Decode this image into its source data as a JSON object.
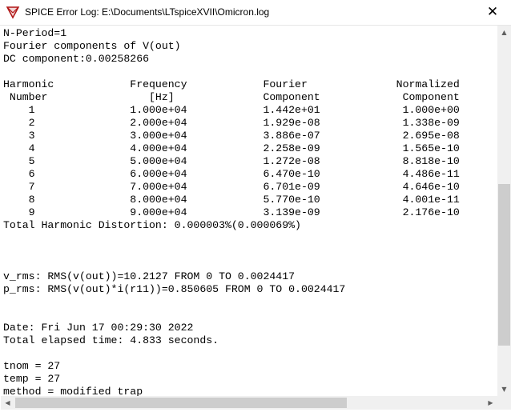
{
  "window": {
    "title": "SPICE Error Log: E:\\Documents\\LTspiceXVII\\Omicron.log",
    "icon": "ltspice-app-icon",
    "close_glyph": "✕"
  },
  "log": {
    "lines": [
      "N-Period=1",
      "Fourier components of V(out)",
      "DC component:0.00258266",
      "",
      "Harmonic            Frequency            Fourier              Normalized",
      " Number                [Hz]              Component             Component",
      "    1               1.000e+04            1.442e+01             1.000e+00",
      "    2               2.000e+04            1.929e-08             1.338e-09",
      "    3               3.000e+04            3.886e-07             2.695e-08",
      "    4               4.000e+04            2.258e-09             1.565e-10",
      "    5               5.000e+04            1.272e-08             8.818e-10",
      "    6               6.000e+04            6.470e-10             4.486e-11",
      "    7               7.000e+04            6.701e-09             4.646e-10",
      "    8               8.000e+04            5.770e-10             4.001e-11",
      "    9               9.000e+04            3.139e-09             2.176e-10",
      "Total Harmonic Distortion: 0.000003%(0.000069%)",
      "",
      "",
      "",
      "v_rms: RMS(v(out))=10.2127 FROM 0 TO 0.0024417",
      "p_rms: RMS(v(out)*i(r11))=0.850605 FROM 0 TO 0.0024417",
      "",
      "",
      "Date: Fri Jun 17 00:29:30 2022",
      "Total elapsed time: 4.833 seconds.",
      "",
      "tnom = 27",
      "temp = 27",
      "method = modified trap"
    ]
  },
  "scrollbars": {
    "up_arrow": "▲",
    "down_arrow": "▼",
    "left_arrow": "◀",
    "right_arrow": "▶"
  }
}
